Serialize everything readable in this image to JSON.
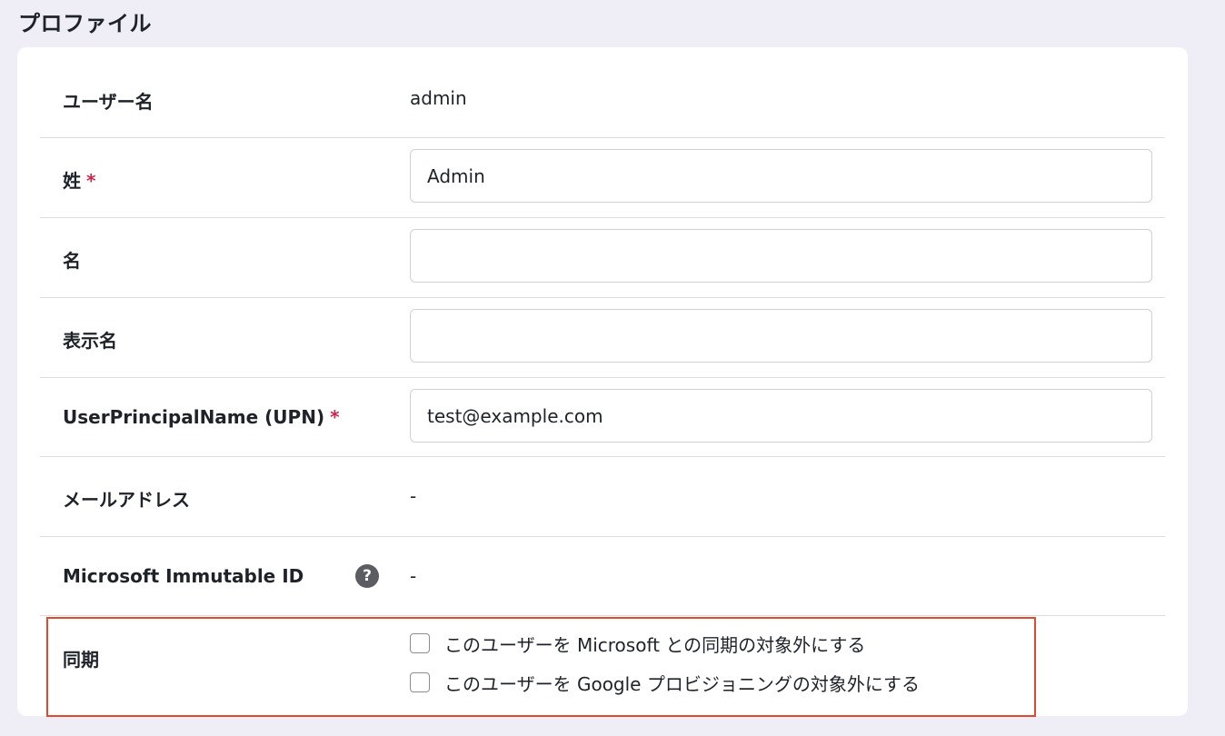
{
  "page": {
    "title": "プロファイル"
  },
  "fields": {
    "username": {
      "label": "ユーザー名",
      "value": "admin"
    },
    "last_name": {
      "label": "姓",
      "required_mark": "*",
      "value": "Admin",
      "placeholder": ""
    },
    "first_name": {
      "label": "名",
      "value": "",
      "placeholder": ""
    },
    "display_name": {
      "label": "表示名",
      "value": "",
      "placeholder": ""
    },
    "upn": {
      "label": "UserPrincipalName (UPN)",
      "required_mark": "*",
      "value": "test@example.com",
      "placeholder": ""
    },
    "email": {
      "label": "メールアドレス",
      "value": "-"
    },
    "immutable_id": {
      "label": "Microsoft Immutable ID",
      "help_icon": "question-circle-icon",
      "help_glyph": "?",
      "value": "-"
    }
  },
  "sync": {
    "label": "同期",
    "options": [
      {
        "label": "このユーザーを Microsoft との同期の対象外にする",
        "checked": false
      },
      {
        "label": "このユーザーを Google プロビジョニングの対象外にする",
        "checked": false
      }
    ]
  },
  "colors": {
    "background": "#efeef7",
    "required": "#d2244b",
    "highlight_border": "#e04a2f"
  }
}
